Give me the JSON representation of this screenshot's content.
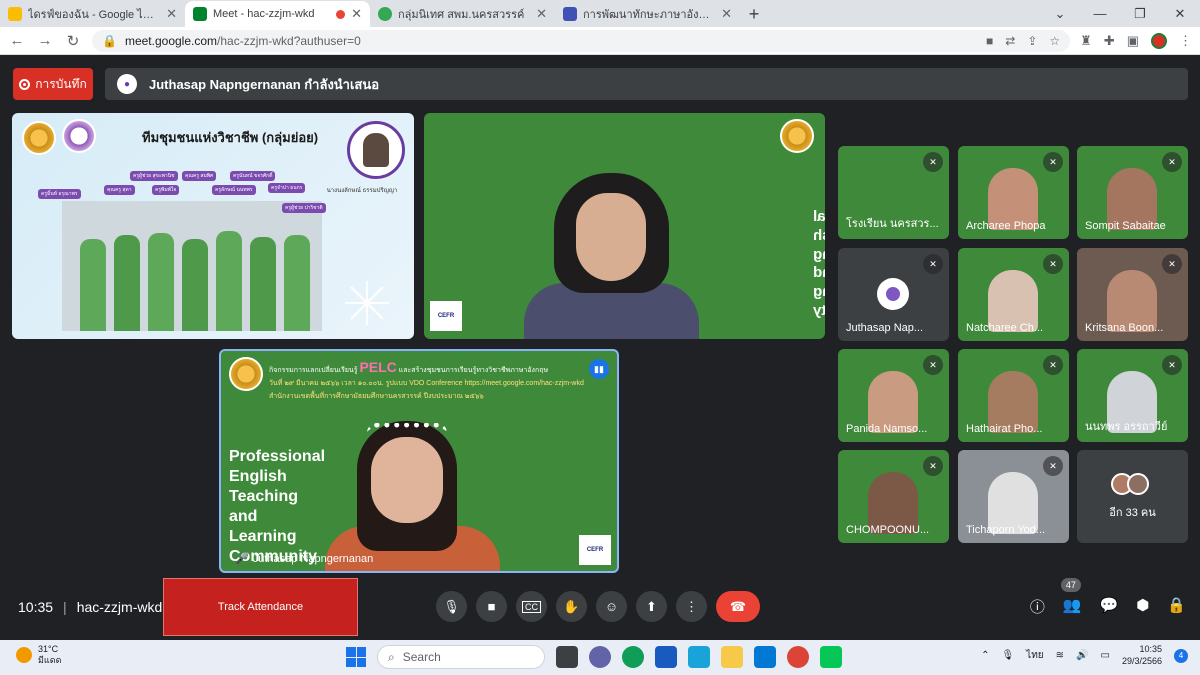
{
  "browser": {
    "tabs": [
      {
        "title": "ไดรฟ์ของฉัน - Google ไดรฟ์",
        "icon": "google-drive-icon",
        "color": "#fbbc04"
      },
      {
        "title": "Meet - hac-zzjm-wkd",
        "icon": "google-meet-icon",
        "color": "#00832d",
        "recording": true
      },
      {
        "title": "กลุ่มนิเทศ สพม.นครสวรรค์",
        "icon": "google-sites-icon",
        "color": "#34a853"
      },
      {
        "title": "การพัฒนาทักษะภาษาอังกฤษ English",
        "icon": "google-forms-icon",
        "color": "#3f51b5"
      }
    ],
    "url_host": "meet.google.com",
    "url_path": "/hac-zzjm-wkd?authuser=0"
  },
  "meet": {
    "record_label": "การบันทึก",
    "presenting_text": "Juthasap Napngernanan กำลังนำเสนอ",
    "banner1": {
      "heading": "ทีมชุมชนแห่งวิชาชีพ (กลุ่มย่อย)",
      "caption": "นางนงลักษณ์ ธรรมปริญญา",
      "tags": [
        "ครูผู้ช่วย สุขะพานิช",
        "คุณครู สุดา",
        "คุณครู สมพิศ",
        "ครูนันทน์ ขจรศักดิ์",
        "ครูมิ้นท์ อรุณาพร",
        "ครูจำปา ธนกร",
        "ครูผู้ช่วย ปาริชาติ",
        "ครูพิมพ์ใจ",
        "ครูลักษณ์ นนทพร"
      ]
    },
    "main_presenter": {
      "mirrored_text": [
        "Professional",
        "English",
        "Teaching",
        "and",
        "Learning",
        "Community"
      ],
      "cefr": "CEFR"
    },
    "main2": {
      "pelc_prefix": "กิจกรรมการแลกเปลี่ยนเรียนรู้",
      "pelc": "PELC",
      "pelc_suffix": "และสร้างชุมชนการเรียนรู้ทางวิชาชีพภาษาอังกฤษ",
      "date_line": "วันที่ ๒๙ มีนาคม ๒๕๖๖ เวลา ๑๐.๐๐น. รูปแบบ VDO Conference https://meet.google.com/hac-zzjm-wkd",
      "office_line": "สำนักงานเขตพื้นที่การศึกษามัธยมศึกษานครสวรรค์ ปีงบประมาณ ๒๕๖๖",
      "title_lines": [
        "Professional",
        "English",
        "Teaching",
        "and",
        "Learning",
        "Community"
      ],
      "name": "Juthasap Napngernanan",
      "cefr": "CEFR"
    },
    "participants": [
      {
        "name": "โรงเรียน นครสวร...",
        "style": "slide"
      },
      {
        "name": "Archaree Phopa",
        "style": "face",
        "skin": "#c49178"
      },
      {
        "name": "Sompit Sabaitae",
        "style": "face",
        "skin": "#a5765f"
      },
      {
        "name": "Juthasap Nap...",
        "style": "avatar"
      },
      {
        "name": "Natcharee Ch...",
        "style": "face",
        "skin": "#d8c1b0"
      },
      {
        "name": "Kritsana Boon...",
        "style": "face",
        "skin": "#b88a73"
      },
      {
        "name": "Panida Namso...",
        "style": "face",
        "skin": "#c99b80"
      },
      {
        "name": "Hathairat Pho...",
        "style": "face",
        "skin": "#a67c60"
      },
      {
        "name": "นนทพร อรรถาวีย์",
        "style": "face",
        "skin": "#d0d3d8"
      },
      {
        "name": "CHOMPOONU...",
        "style": "face",
        "skin": "#7c5846"
      },
      {
        "name": "Tichaporn Yod...",
        "style": "face",
        "skin": "#e0e0e0"
      }
    ],
    "more_label": "อีก 33 คน",
    "meeting_time": "10:35",
    "meeting_code": "hac-zzjm-wkd",
    "track_attendance_label": "Track Attendance",
    "participant_count": "47"
  },
  "taskbar": {
    "temp": "31°C",
    "weather": "มีแดด",
    "search_label": "Search",
    "lang": "ไทย",
    "time": "10:35",
    "date": "29/3/2566",
    "notifications": "4"
  }
}
